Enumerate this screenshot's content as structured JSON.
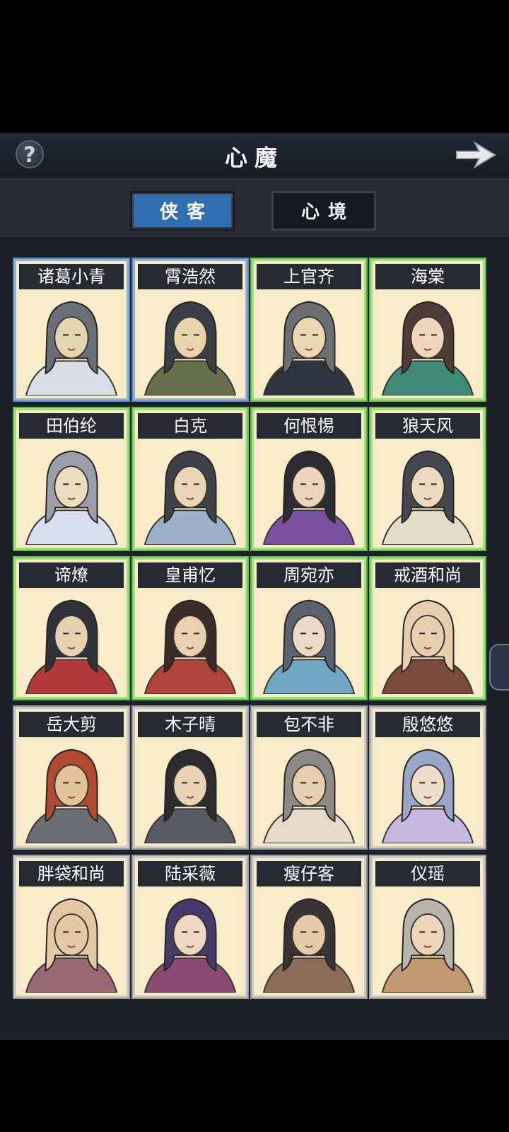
{
  "header": {
    "title": "心魔",
    "help_icon": "question-mark-icon",
    "next_icon": "arrow-right-icon"
  },
  "tabs": [
    {
      "label": "侠客",
      "active": true
    },
    {
      "label": "心境",
      "active": false
    }
  ],
  "colors": {
    "frame_blue": "#5b86b8",
    "frame_green": "#63b84a",
    "frame_grey": "#9a9a9a",
    "tab_active": "#2f6fb0",
    "card_bg": "#f6ebc6"
  },
  "characters": [
    {
      "name": "诸葛小青",
      "frame": "blue"
    },
    {
      "name": "霄浩然",
      "frame": "blue"
    },
    {
      "name": "上官齐",
      "frame": "green"
    },
    {
      "name": "海棠",
      "frame": "green"
    },
    {
      "name": "田伯纶",
      "frame": "green"
    },
    {
      "name": "白克",
      "frame": "green"
    },
    {
      "name": "何恨惕",
      "frame": "green"
    },
    {
      "name": "狼天风",
      "frame": "green"
    },
    {
      "name": "谛燎",
      "frame": "green"
    },
    {
      "name": "皇甫忆",
      "frame": "green"
    },
    {
      "name": "周宛亦",
      "frame": "green"
    },
    {
      "name": "戒酒和尚",
      "frame": "green"
    },
    {
      "name": "岳大剪",
      "frame": "grey"
    },
    {
      "name": "木子晴",
      "frame": "grey"
    },
    {
      "name": "包不非",
      "frame": "grey"
    },
    {
      "name": "殷悠悠",
      "frame": "grey"
    },
    {
      "name": "胖袋和尚",
      "frame": "grey"
    },
    {
      "name": "陆采薇",
      "frame": "grey"
    },
    {
      "name": "瘦仔客",
      "frame": "grey"
    },
    {
      "name": "仪瑶",
      "frame": "grey"
    }
  ]
}
